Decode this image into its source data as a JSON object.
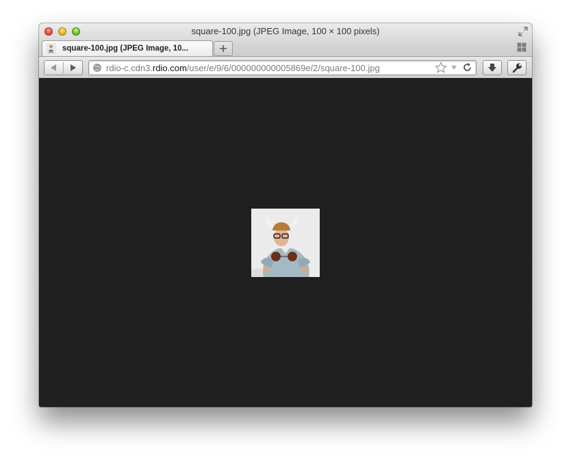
{
  "window": {
    "title": "square-100.jpg (JPEG Image, 100 × 100 pixels)"
  },
  "tabs": [
    {
      "label": "square-100.jpg (JPEG Image, 10...",
      "active": true
    }
  ],
  "navigation": {
    "url_prefix": "rdio-c.cdn3.",
    "url_domain": "rdio.com",
    "url_path": "/user/e/9/6/000000000005869e/2/square-100.jpg"
  },
  "colors": {
    "content_background": "#1e1e1e",
    "chrome_background": "#d2d2d2"
  }
}
